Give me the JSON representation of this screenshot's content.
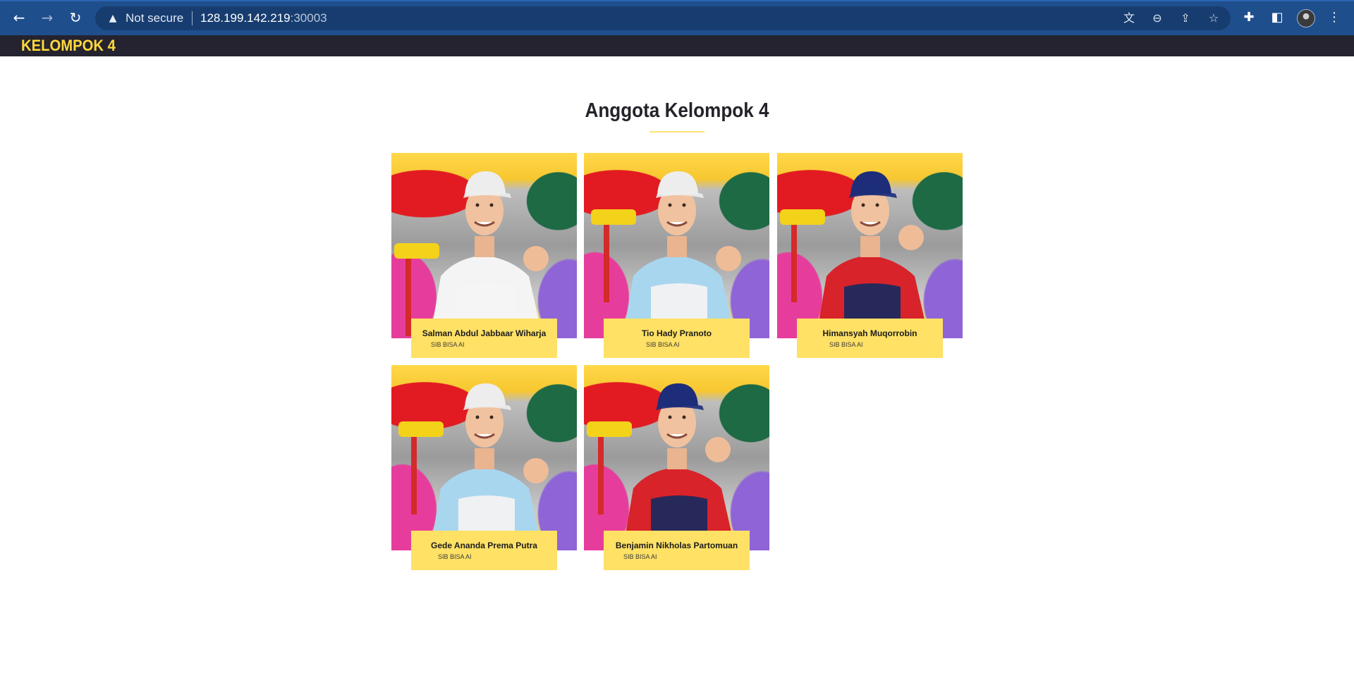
{
  "browser": {
    "security_label": "Not secure",
    "url_host": "128.199.142.219",
    "url_port": ":30003"
  },
  "site": {
    "brand": "KELOMPOK 4",
    "accent_color": "#ffd83b",
    "header_color": "#24232f"
  },
  "section": {
    "title": "Anggota Kelompok 4"
  },
  "members": [
    {
      "name": "Salman Abdul Jabbaar Wiharja",
      "role": "SIB BISA AI",
      "shirt": "white",
      "cap": "white"
    },
    {
      "name": "Tio Hady Pranoto",
      "role": "SIB BISA AI",
      "shirt": "light-blue",
      "cap": "white"
    },
    {
      "name": "Himansyah Muqorrobin",
      "role": "SIB BISA AI",
      "shirt": "red",
      "cap": "navy"
    },
    {
      "name": "Gede Ananda Prema Putra",
      "role": "SIB BISA AI",
      "shirt": "light-blue",
      "cap": "white"
    },
    {
      "name": "Benjamin Nikholas Partomuan",
      "role": "SIB BISA AI",
      "shirt": "red",
      "cap": "navy"
    }
  ]
}
